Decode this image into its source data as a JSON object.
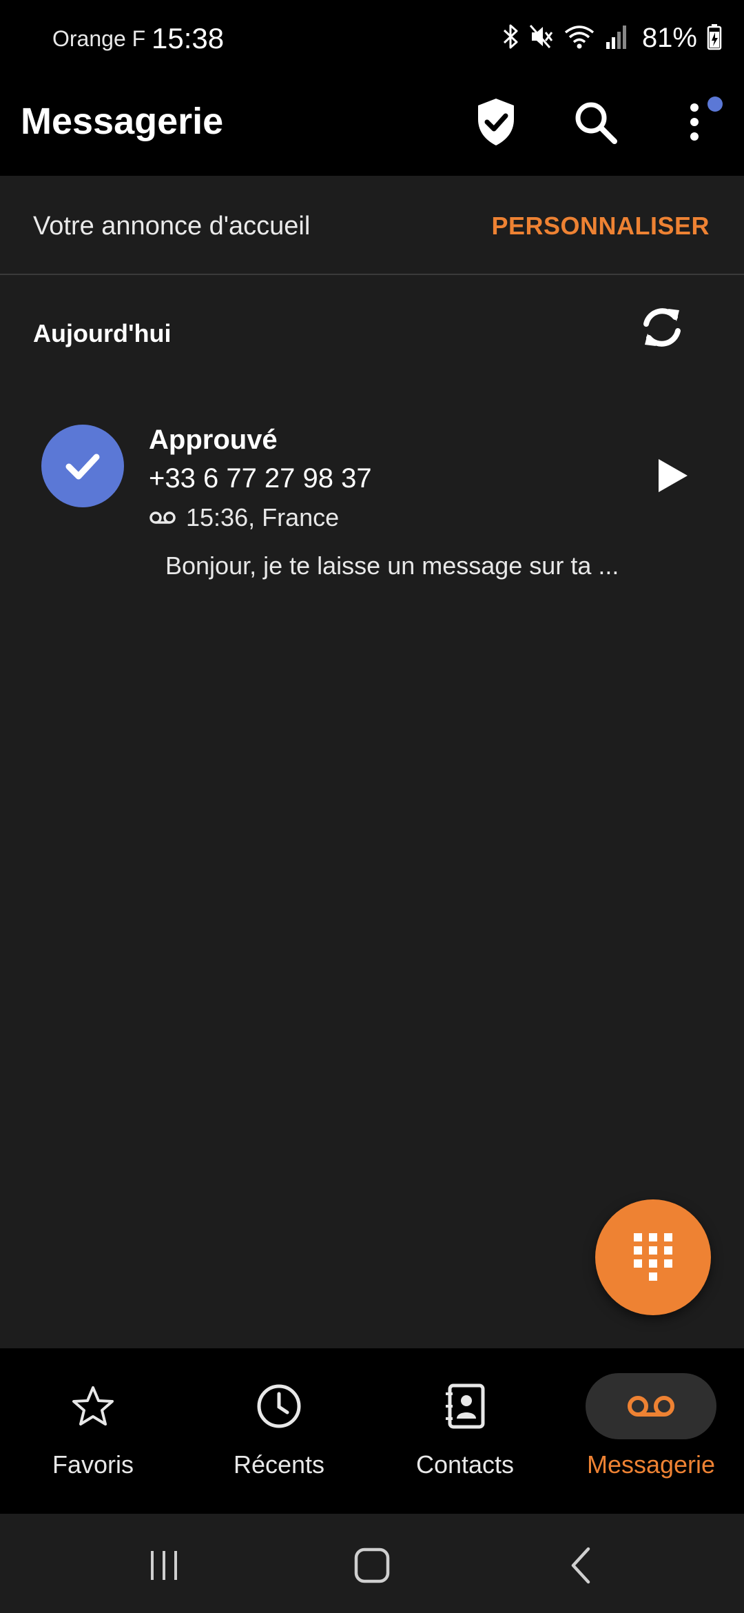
{
  "status_bar": {
    "carrier": "Orange F",
    "time": "15:38",
    "battery": "81%",
    "icons": [
      "bluetooth-icon",
      "mute-icon",
      "wifi-icon",
      "signal-icon",
      "battery-icon"
    ]
  },
  "app_bar": {
    "title": "Messagerie",
    "actions": [
      "shield-check-icon",
      "search-icon",
      "more-vert-icon"
    ],
    "notification_dot_color": "#5b78d6"
  },
  "greeting": {
    "label": "Votre annonce d'accueil",
    "action": "PERSONNALISER"
  },
  "section": {
    "title": "Aujourd'hui"
  },
  "voicemails": [
    {
      "name": "Approuvé",
      "number": "+33 6 77 27 98 37",
      "time_location": "15:36, France",
      "preview": "Bonjour, je te laisse un message sur ta ...",
      "avatar_color": "#5b78d6"
    }
  ],
  "bottom_nav": {
    "items": [
      {
        "label": "Favoris",
        "icon": "star-icon",
        "active": false
      },
      {
        "label": "Récents",
        "icon": "clock-icon",
        "active": false
      },
      {
        "label": "Contacts",
        "icon": "contacts-icon",
        "active": false
      },
      {
        "label": "Messagerie",
        "icon": "voicemail-icon",
        "active": true
      }
    ]
  },
  "colors": {
    "accent": "#ee8233",
    "background": "#1d1d1d",
    "bar": "#000000",
    "avatar": "#5b78d6"
  }
}
